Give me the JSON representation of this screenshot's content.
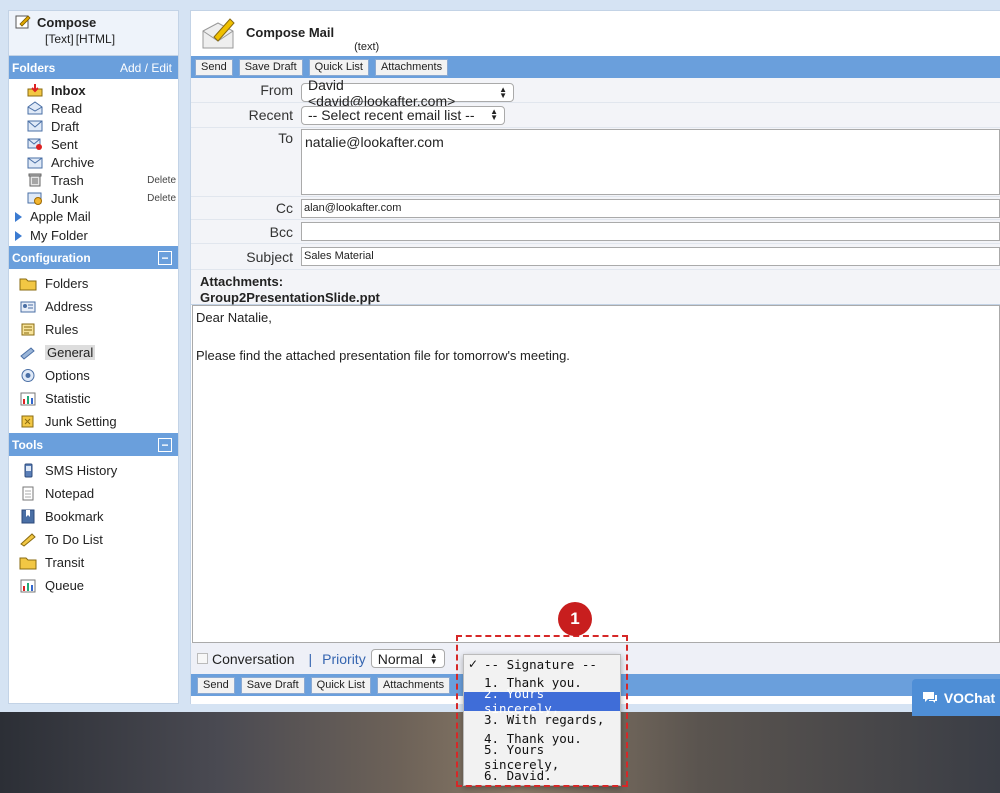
{
  "sidebar": {
    "compose_title": "Compose",
    "compose_modes": [
      "[Text]",
      "[HTML]"
    ],
    "folders_header": "Folders",
    "folders_edit": "Add / Edit",
    "folders": [
      {
        "label": "Inbox",
        "icon": "inbox-icon"
      },
      {
        "label": "Read",
        "icon": "read-icon"
      },
      {
        "label": "Draft",
        "icon": "draft-icon"
      },
      {
        "label": "Sent",
        "icon": "sent-icon"
      },
      {
        "label": "Archive",
        "icon": "archive-icon"
      },
      {
        "label": "Trash",
        "icon": "trash-icon",
        "action": "Delete"
      },
      {
        "label": "Junk",
        "icon": "junk-icon",
        "action": "Delete"
      }
    ],
    "extra_folders": [
      "Apple Mail",
      "My Folder"
    ],
    "config_header": "Configuration",
    "config_items": [
      "Folders",
      "Address",
      "Rules",
      "General",
      "Options",
      "Statistic",
      "Junk Setting"
    ],
    "tools_header": "Tools",
    "tools_items": [
      "SMS History",
      "Notepad",
      "Bookmark",
      "To Do List",
      "Transit",
      "Queue"
    ],
    "collapse_symbol": "−"
  },
  "main": {
    "title": "Compose Mail",
    "mode": "(text)",
    "toolbar": [
      "Send",
      "Save Draft",
      "Quick List",
      "Attachments"
    ],
    "from_label": "From",
    "from_value": "David <david@lookafter.com>",
    "recent_label": "Recent",
    "recent_value": "-- Select recent email list --",
    "to_label": "To",
    "to_value": "natalie@lookafter.com",
    "cc_label": "Cc",
    "cc_value": "alan@lookafter.com",
    "bcc_label": "Bcc",
    "bcc_value": "",
    "subject_label": "Subject",
    "subject_value": "Sales Material",
    "attachments_label": "Attachments:",
    "attachment_file": "Group2PresentationSlide.ppt",
    "body_lines": [
      "Dear Natalie,",
      "",
      "Please find the attached presentation file for tomorrow's meeting."
    ],
    "conversation_label": "Conversation",
    "separator": "|",
    "priority_label": "Priority",
    "priority_value": "Normal",
    "bottom_toolbar": [
      "Send",
      "Save Draft",
      "Quick List",
      "Attachments"
    ]
  },
  "signature_menu": {
    "options": [
      "-- Signature --",
      "1. Thank you.",
      "2. Yours sincerely,",
      "3. With regards,",
      "4. Thank you.",
      "5. Yours sincerely,",
      "6. David."
    ],
    "checked_index": 0,
    "highlighted_index": 2
  },
  "annotation": {
    "badge": "1"
  },
  "vochat": {
    "label": "VOChat"
  },
  "colors": {
    "header_blue": "#6a9fdc",
    "highlight": "#3f6dd8",
    "badge_red": "#c81e1e"
  }
}
